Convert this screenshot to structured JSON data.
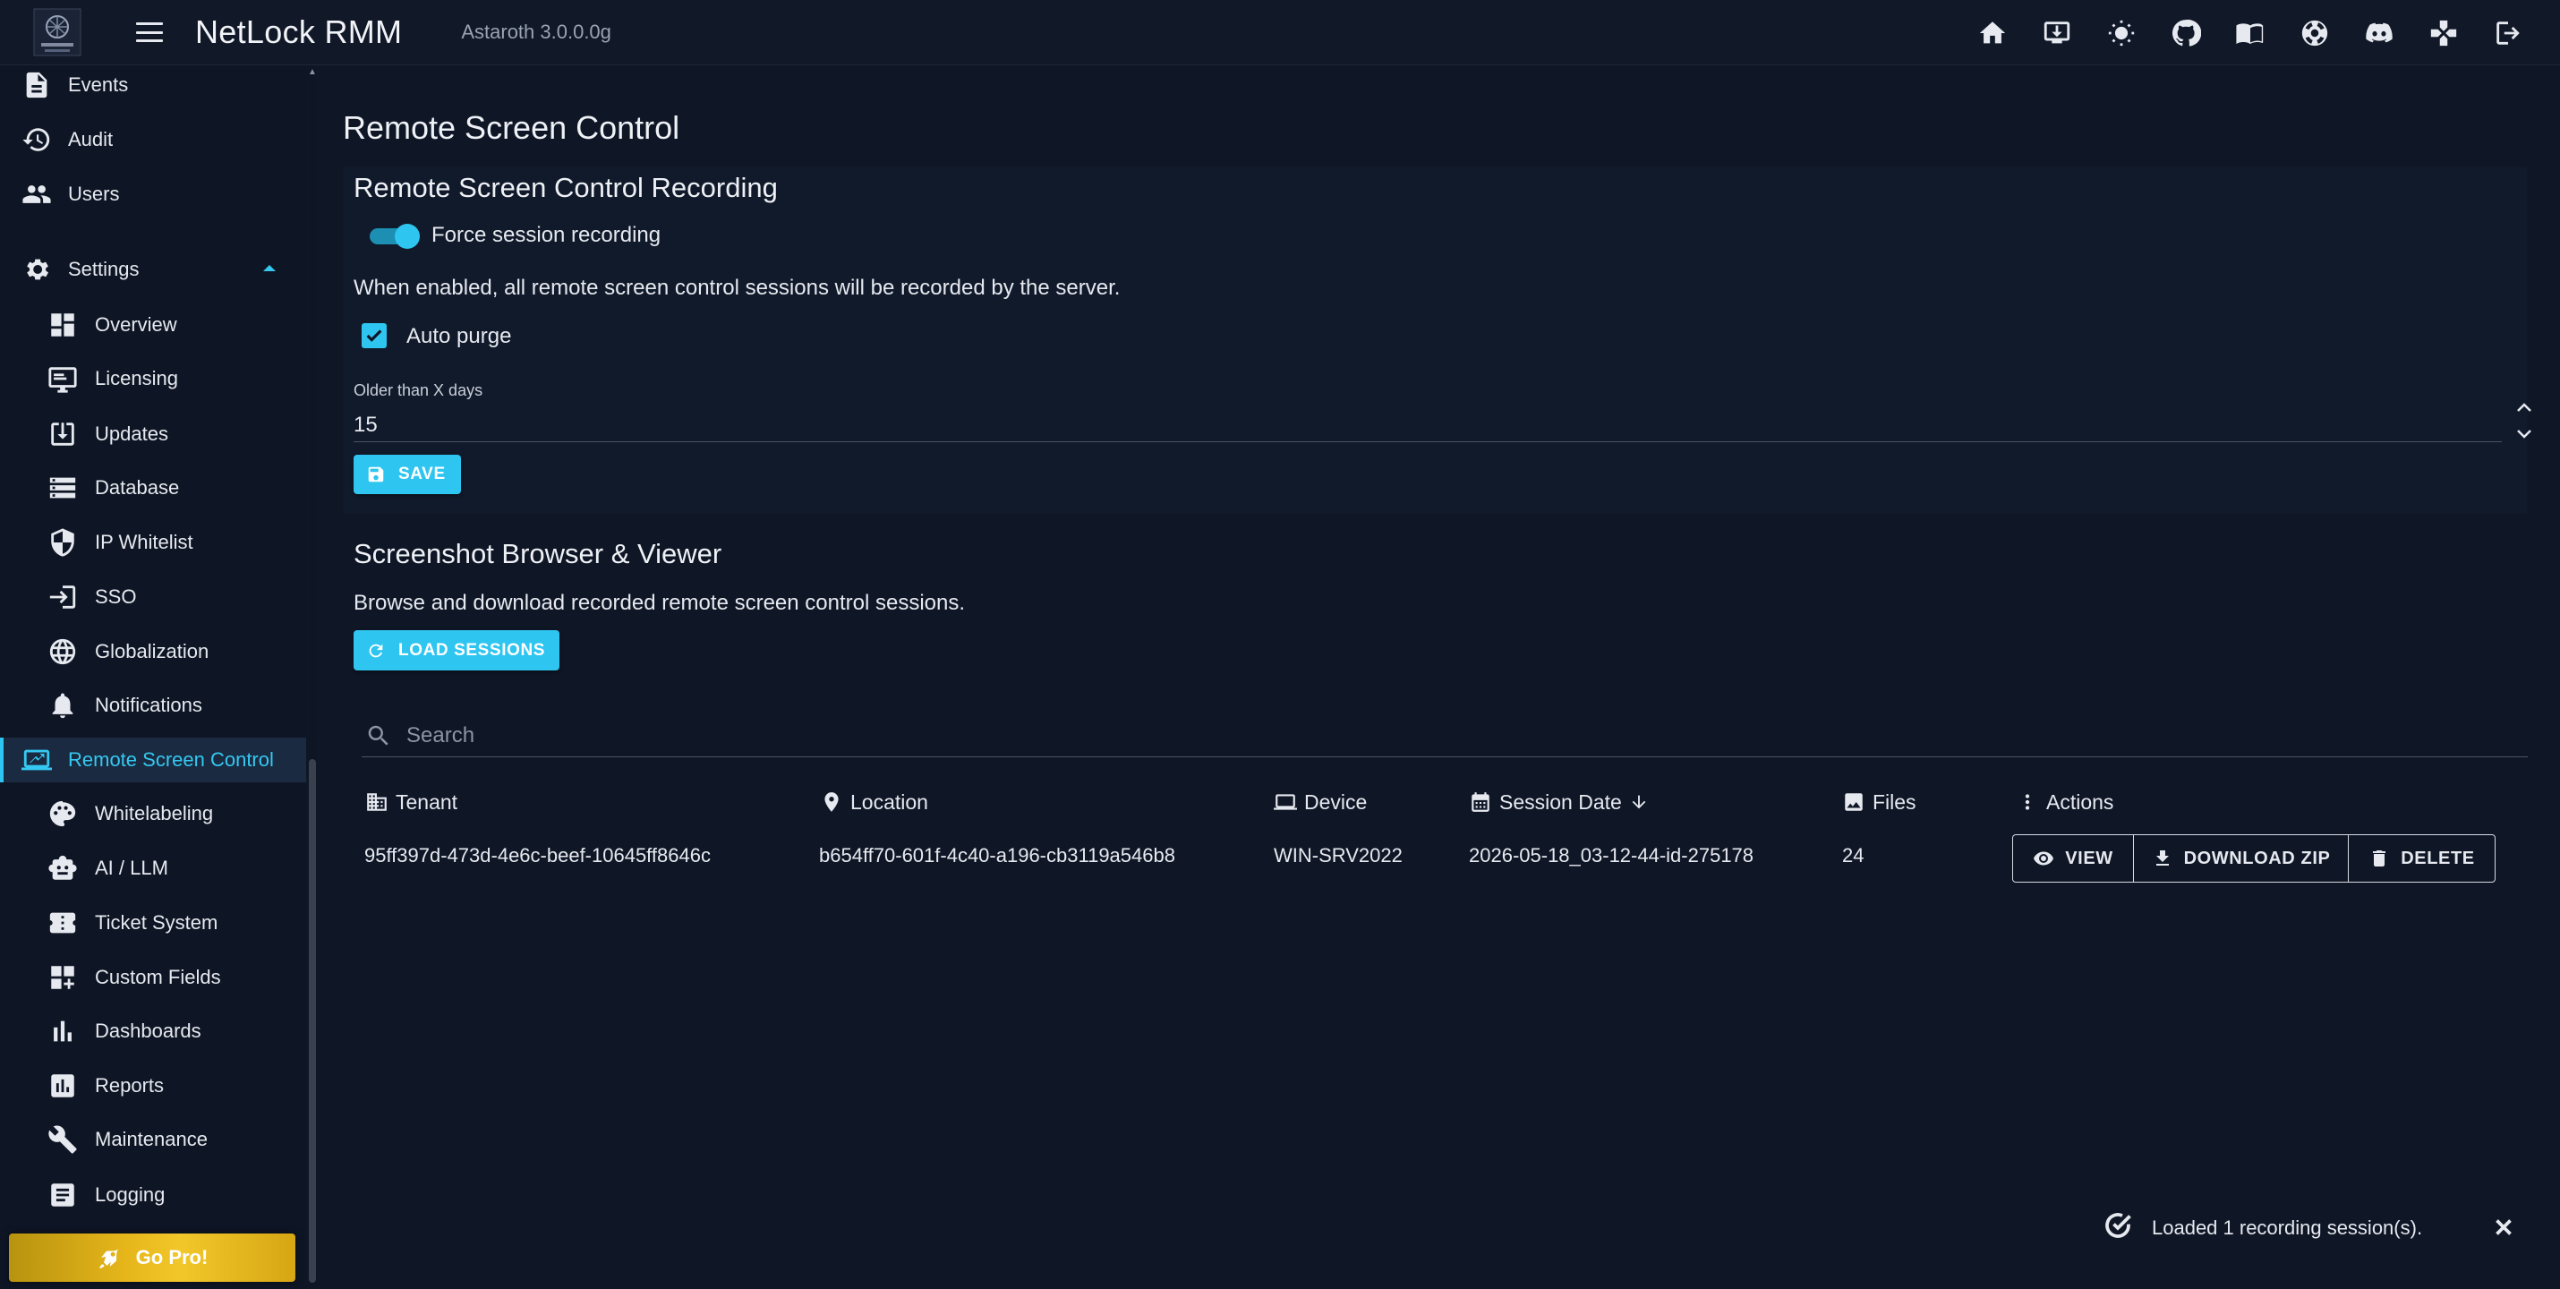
{
  "app": {
    "title": "NetLock RMM",
    "version": "Astaroth 3.0.0.0g"
  },
  "topbar": {
    "icons": [
      "home-icon",
      "install-icon",
      "theme-toggle-icon",
      "github-icon",
      "docs-icon",
      "support-icon",
      "discord-icon",
      "games-icon",
      "logout-icon"
    ]
  },
  "sidebar": {
    "items": [
      {
        "label": "Events",
        "icon": "events-icon"
      },
      {
        "label": "Audit",
        "icon": "audit-icon"
      },
      {
        "label": "Users",
        "icon": "users-icon"
      }
    ],
    "settings": {
      "label": "Settings",
      "icon": "gear-icon",
      "expanded": true
    },
    "settings_items": [
      {
        "label": "Overview",
        "icon": "dashboard-icon"
      },
      {
        "label": "Licensing",
        "icon": "licensing-icon"
      },
      {
        "label": "Updates",
        "icon": "updates-icon"
      },
      {
        "label": "Database",
        "icon": "database-icon"
      },
      {
        "label": "IP Whitelist",
        "icon": "shield-icon"
      },
      {
        "label": "SSO",
        "icon": "login-icon"
      },
      {
        "label": "Globalization",
        "icon": "globe-icon"
      },
      {
        "label": "Notifications",
        "icon": "bell-icon"
      },
      {
        "label": "Remote Screen Control",
        "icon": "remote-screen-icon",
        "active": true
      },
      {
        "label": "Whitelabeling",
        "icon": "palette-icon"
      },
      {
        "label": "AI / LLM",
        "icon": "robot-icon"
      },
      {
        "label": "Ticket System",
        "icon": "ticket-icon"
      },
      {
        "label": "Custom Fields",
        "icon": "custom-fields-icon"
      },
      {
        "label": "Dashboards",
        "icon": "bar-chart-icon"
      },
      {
        "label": "Reports",
        "icon": "reports-icon"
      },
      {
        "label": "Maintenance",
        "icon": "wrench-icon"
      },
      {
        "label": "Logging",
        "icon": "logging-icon"
      }
    ],
    "gopro": {
      "label": "Go Pro!"
    }
  },
  "page": {
    "title": "Remote Screen Control",
    "recording": {
      "title": "Remote Screen Control Recording",
      "force_label": "Force session recording",
      "force_enabled": true,
      "description": "When enabled, all remote screen control sessions will be recorded by the server.",
      "auto_purge_label": "Auto purge",
      "auto_purge_checked": true,
      "older_label": "Older than X days",
      "older_value": "15",
      "save_label": "SAVE"
    },
    "browser": {
      "title": "Screenshot Browser & Viewer",
      "description": "Browse and download recorded remote screen control sessions.",
      "load_label": "LOAD SESSIONS",
      "search_placeholder": "Search",
      "columns": [
        "Tenant",
        "Location",
        "Device",
        "Session Date",
        "Files",
        "Actions"
      ],
      "rows": [
        {
          "tenant": "95ff397d-473d-4e6c-beef-10645ff8646c",
          "location": "b654ff70-601f-4c40-a196-cb3119a546b8",
          "device": "WIN-SRV2022",
          "session_date": "2026-05-18_03-12-44-id-275178",
          "files": "24"
        }
      ],
      "actions": {
        "view": "VIEW",
        "download": "DOWNLOAD ZIP",
        "delete": "DELETE"
      }
    }
  },
  "snackbar": {
    "message": "Loaded 1 recording session(s)."
  },
  "colors": {
    "accent": "#2ec5f0",
    "background": "#0f1626",
    "gopro": "#e5b51a"
  }
}
